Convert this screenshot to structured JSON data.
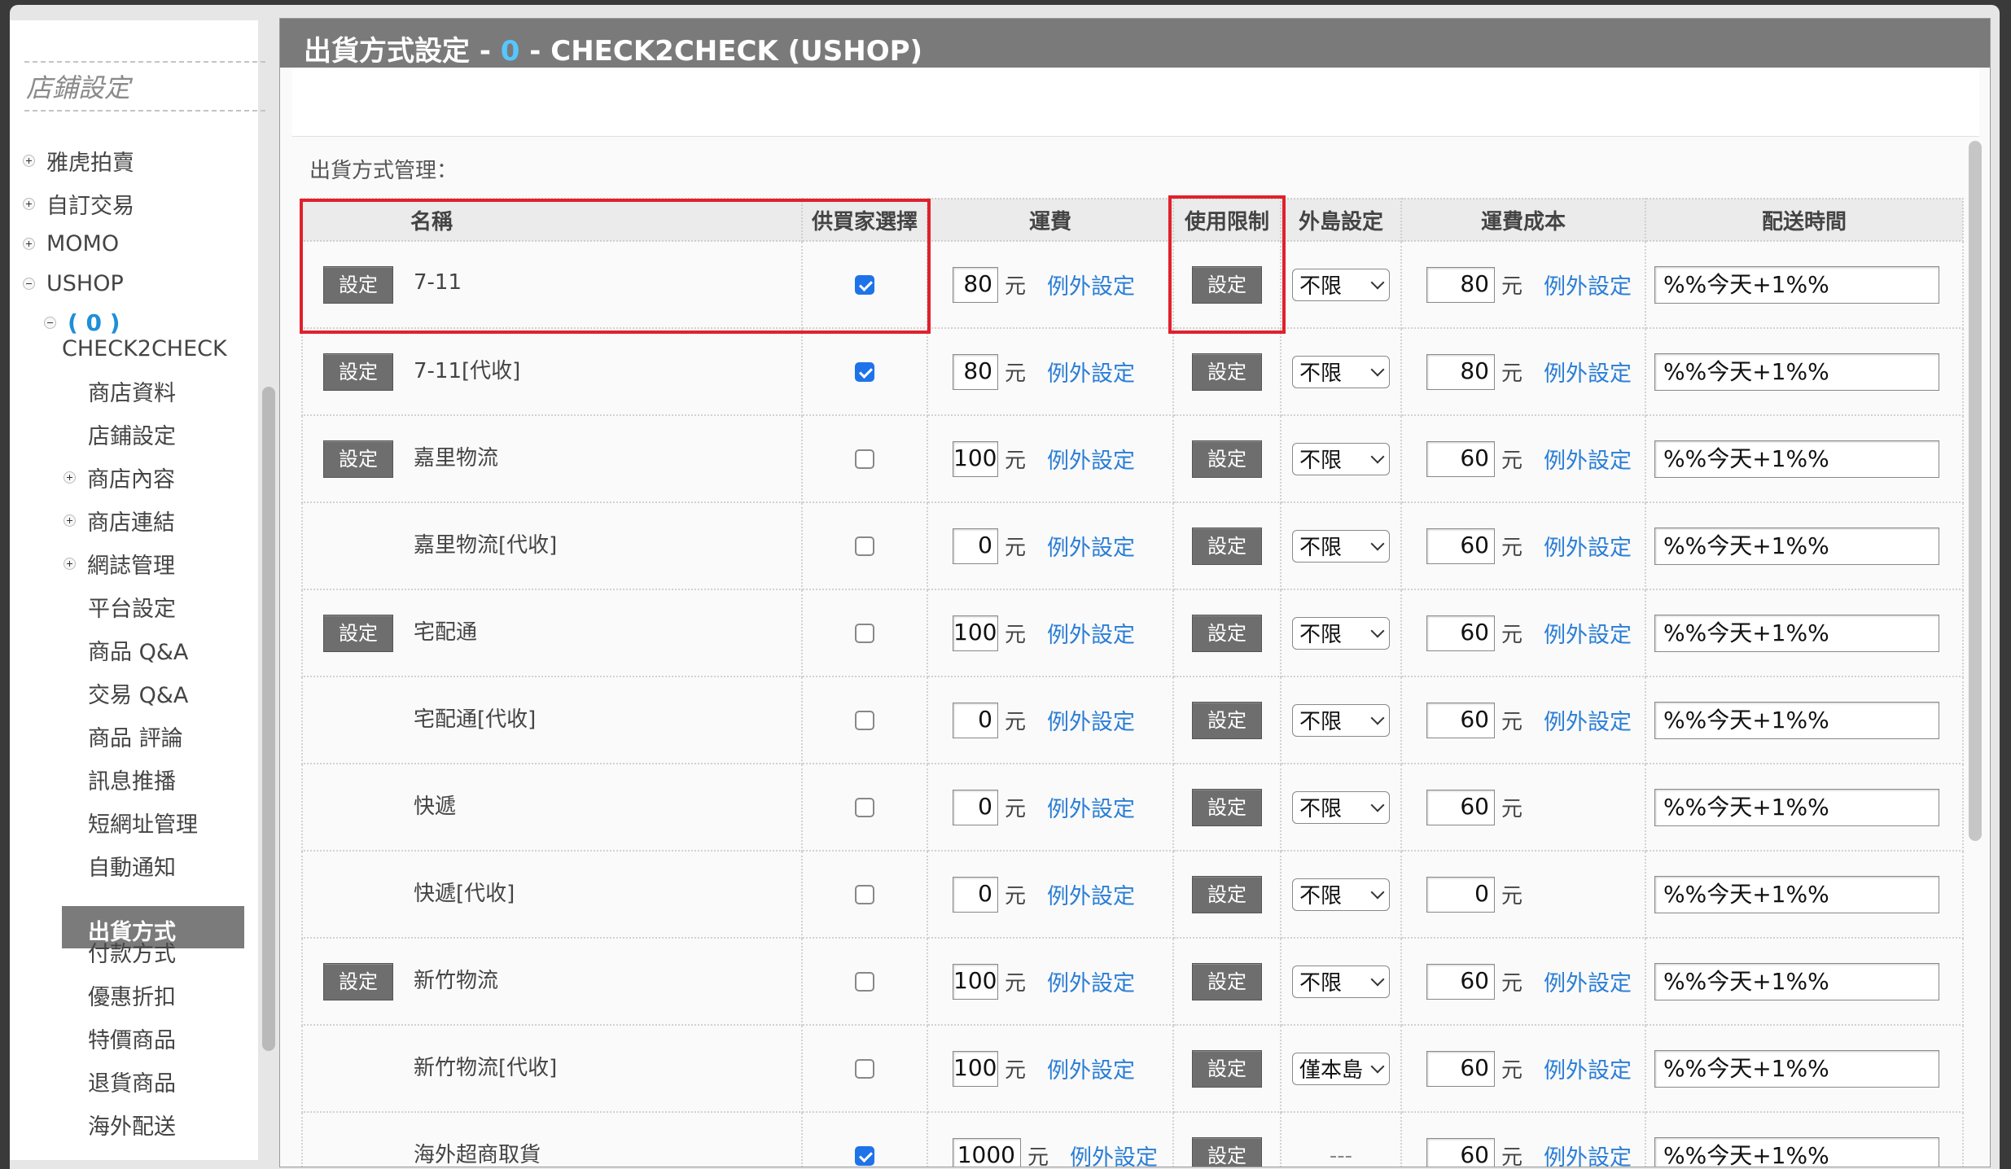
{
  "sidebar": {
    "title": "店鋪設定",
    "items": [
      "雅虎拍賣",
      "自訂交易",
      "MOMO",
      "USHOP"
    ],
    "shop_num": "( 0 )",
    "shop_name": "CHECK2CHECK",
    "subitems": [
      "商店資料",
      "店鋪設定",
      "商店內容",
      "商店連結",
      "網誌管理",
      "平台設定",
      "商品 Q&A",
      "交易 Q&A",
      "商品 評論",
      "訊息推播",
      "短網址管理",
      "自動通知",
      "出貨方式",
      "付款方式",
      "優惠折扣",
      "特價商品",
      "退貨商品",
      "海外配送"
    ],
    "active": "出貨方式"
  },
  "header": {
    "title_prefix": "出貨方式設定 - ",
    "count": "0",
    "title_suffix": " - CHECK2CHECK (USHOP)"
  },
  "section_label": "出貨方式管理：",
  "table": {
    "headers": [
      "名稱",
      "供買家選擇",
      "運費",
      "使用限制",
      "外島設定",
      "運費成本",
      "配送時間"
    ],
    "set_label": "設定",
    "unit": "元",
    "exception_label": "例外設定",
    "rows": [
      {
        "name": "7-11",
        "has_set": true,
        "checked": true,
        "fee": "80",
        "island": "不限",
        "cost": "80",
        "cost_exc": true,
        "time": "%%今天+1%%"
      },
      {
        "name": "7-11[代收]",
        "has_set": true,
        "checked": true,
        "fee": "80",
        "island": "不限",
        "cost": "80",
        "cost_exc": true,
        "time": "%%今天+1%%"
      },
      {
        "name": "嘉里物流",
        "has_set": true,
        "checked": false,
        "fee": "100",
        "island": "不限",
        "cost": "60",
        "cost_exc": true,
        "time": "%%今天+1%%"
      },
      {
        "name": "嘉里物流[代收]",
        "has_set": false,
        "checked": false,
        "fee": "0",
        "island": "不限",
        "cost": "60",
        "cost_exc": true,
        "time": "%%今天+1%%"
      },
      {
        "name": "宅配通",
        "has_set": true,
        "checked": false,
        "fee": "100",
        "island": "不限",
        "cost": "60",
        "cost_exc": true,
        "time": "%%今天+1%%"
      },
      {
        "name": "宅配通[代收]",
        "has_set": false,
        "checked": false,
        "fee": "0",
        "island": "不限",
        "cost": "60",
        "cost_exc": true,
        "time": "%%今天+1%%"
      },
      {
        "name": "快遞",
        "has_set": false,
        "checked": false,
        "fee": "0",
        "island": "不限",
        "cost": "60",
        "cost_exc": false,
        "time": "%%今天+1%%"
      },
      {
        "name": "快遞[代收]",
        "has_set": false,
        "checked": false,
        "fee": "0",
        "island": "不限",
        "cost": "0",
        "cost_exc": false,
        "time": "%%今天+1%%"
      },
      {
        "name": "新竹物流",
        "has_set": true,
        "checked": false,
        "fee": "100",
        "island": "不限",
        "cost": "60",
        "cost_exc": true,
        "time": "%%今天+1%%"
      },
      {
        "name": "新竹物流[代收]",
        "has_set": false,
        "checked": false,
        "fee": "100",
        "island": "僅本島",
        "cost": "60",
        "cost_exc": true,
        "time": "%%今天+1%%"
      },
      {
        "name": "海外超商取貨",
        "has_set": false,
        "checked": true,
        "fee": "1000",
        "island": "---",
        "cost": "60",
        "cost_exc": true,
        "time": "%%今天+1%%"
      }
    ]
  },
  "colors": {
    "header_bg": "#7a7a7a",
    "count_color": "#56c6ff",
    "link": "#2a7ed6",
    "checkbox": "#1f73e8",
    "highlight": "#e0212c"
  }
}
